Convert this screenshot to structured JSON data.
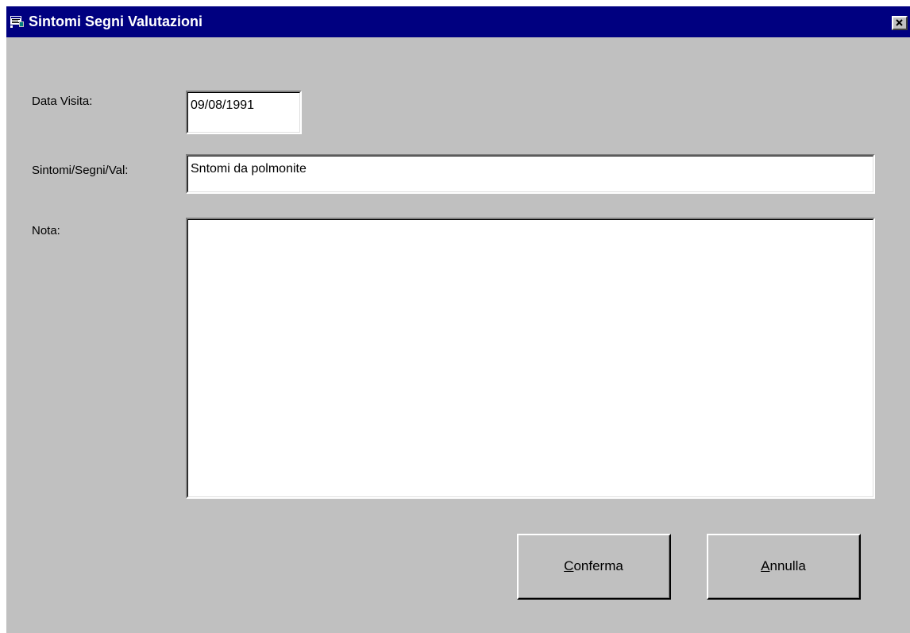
{
  "window": {
    "title": "Sintomi Segni Valutazioni",
    "icon": "form-app-icon",
    "close_icon": "close-icon"
  },
  "form": {
    "data_visita": {
      "label": "Data Visita:",
      "value": "09/08/1991"
    },
    "sintomi": {
      "label": "Sintomi/Segni/Val:",
      "value": "Sntomi da polmonite"
    },
    "nota": {
      "label": "Nota:",
      "value": ""
    }
  },
  "buttons": {
    "conferma": {
      "accel": "C",
      "rest": "onferma"
    },
    "annulla": {
      "accel": "A",
      "rest": "nnulla"
    }
  },
  "colors": {
    "titlebar": "#000080",
    "face": "#c0c0c0",
    "field": "#ffffff"
  }
}
